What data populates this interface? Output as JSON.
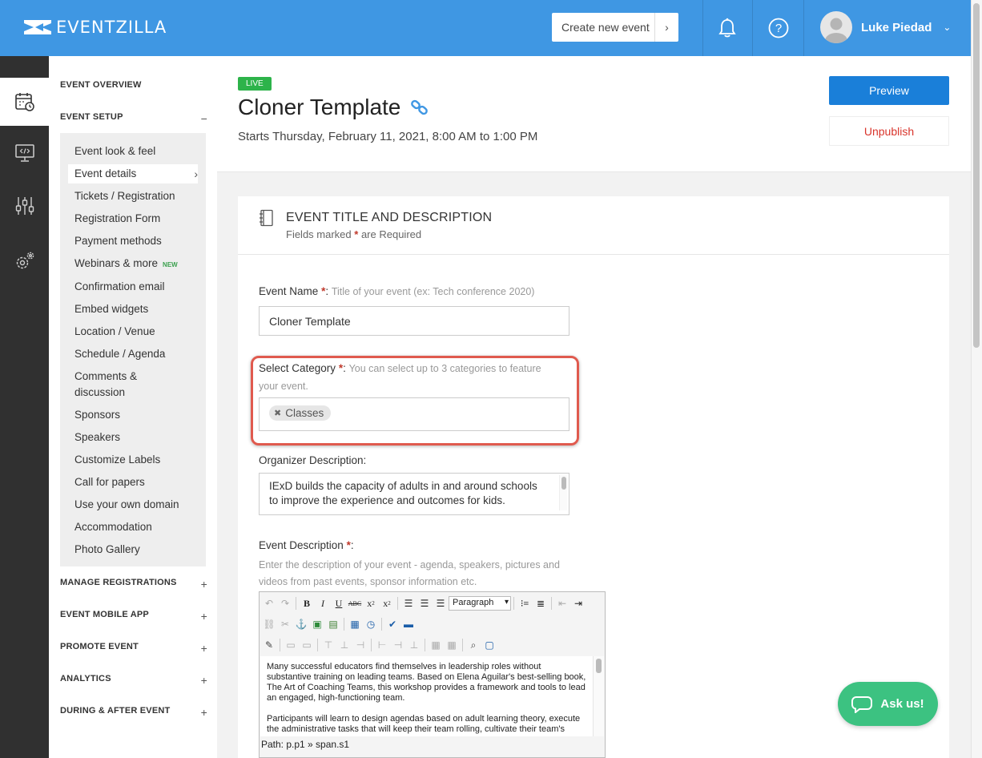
{
  "brand": {
    "logo_text": "EVENTZILLA",
    "primary_color": "#3f97e3"
  },
  "topbar": {
    "create_label": "Create new event",
    "user_name": "Luke Piedad"
  },
  "rail": {
    "items": [
      {
        "icon": "calendar-icon",
        "active": true
      },
      {
        "icon": "monitor-code-icon",
        "active": false
      },
      {
        "icon": "sliders-icon",
        "active": false
      },
      {
        "icon": "gears-icon",
        "active": false
      }
    ]
  },
  "sidebar": {
    "overview": "EVENT OVERVIEW",
    "setup": "EVENT SETUP",
    "setup_items": [
      "Event look & feel",
      "Event details",
      "Tickets / Registration",
      "Registration Form",
      "Payment methods",
      "Webinars & more",
      "Confirmation email",
      "Embed widgets",
      "Location / Venue",
      "Schedule / Agenda",
      "Comments &",
      "discussion",
      "Sponsors",
      "Speakers",
      "Customize Labels",
      "Call for papers",
      "Use your own domain",
      "Accommodation",
      "Photo Gallery"
    ],
    "new_badge": "NEW",
    "sections": [
      "MANAGE REGISTRATIONS",
      "EVENT MOBILE APP",
      "PROMOTE EVENT",
      "ANALYTICS",
      "DURING & AFTER EVENT"
    ]
  },
  "event": {
    "status": "LIVE",
    "title": "Cloner Template",
    "dates": "Starts Thursday, February 11, 2021, 8:00 AM to 1:00 PM",
    "preview_label": "Preview",
    "unpublish_label": "Unpublish"
  },
  "form": {
    "section_title": "EVENT TITLE AND DESCRIPTION",
    "fields_marked": "Fields marked",
    "are_required": "are Required",
    "name_label": "Event Name",
    "name_hint": "Title of your event (ex: Tech conference 2020)",
    "name_value": "Cloner Template",
    "category_label": "Select Category",
    "category_hint_1": "You can select up to 3 categories to feature",
    "category_hint_2": "your event.",
    "category_tag": "Classes",
    "organizer_label": "Organizer Description:",
    "organizer_text_1": "IExD builds the capacity of adults in and around schools",
    "organizer_text_2": "to improve the experience and outcomes for kids.",
    "description_label": "Event Description",
    "description_hint_1": "Enter the description of your event - agenda, speakers, pictures and",
    "description_hint_2": "videos from past events, sponsor information etc.",
    "editor_paragraph": "Paragraph",
    "editor_p1": [
      "Many successful educators find themselves in leadership roles without",
      "substantive training on leading teams. Based on Elena Aguilar's best-selling book,",
      "The Art of Coaching Teams, this workshop provides a framework and tools to lead",
      "an engaged, high-functioning team."
    ],
    "editor_p2": [
      "Participants will learn to design agendas based on adult learning theory, execute",
      "the administrative tasks that will keep their team rolling, cultivate their team's"
    ],
    "editor_path": "Path: p.p1 » span.s1"
  },
  "chat": {
    "label": "Ask us!"
  }
}
